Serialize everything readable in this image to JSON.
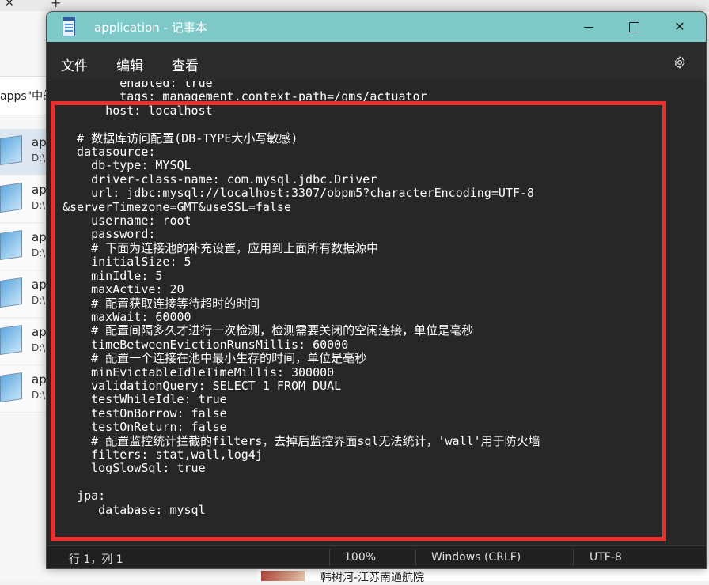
{
  "background": {
    "explorer_strip_text": "apps\"中的",
    "files": [
      {
        "name": "ap",
        "path": "D:\\"
      },
      {
        "name": "ap",
        "path": "D:\\"
      },
      {
        "name": "ap",
        "path": "D:\\"
      },
      {
        "name": "ap",
        "path": "D:\\"
      },
      {
        "name": "ap",
        "path": "D:\\"
      },
      {
        "name": "ap",
        "path": "D:\\"
      }
    ],
    "bottom_text": "韩树河-江苏南通航院"
  },
  "window": {
    "title": "application - 记事本",
    "controls": {
      "minimize": "minimize",
      "maximize": "maximize",
      "close": "✕"
    }
  },
  "menu": {
    "file": "文件",
    "edit": "编辑",
    "view": "查看"
  },
  "editor": {
    "lines": [
      "        enabled: true",
      "        tags: management.context-path=/qms/actuator",
      "      host: localhost",
      "",
      "  # 数据库访问配置(DB-TYPE大小写敏感)",
      "  datasource:",
      "    db-type: MYSQL",
      "    driver-class-name: com.mysql.jdbc.Driver",
      "    url: jdbc:mysql://localhost:3307/obpm5?characterEncoding=UTF-8",
      "&serverTimezone=GMT&useSSL=false",
      "    username: root",
      "    password:",
      "    # 下面为连接池的补充设置，应用到上面所有数据源中",
      "    initialSize: 5",
      "    minIdle: 5",
      "    maxActive: 20",
      "    # 配置获取连接等待超时的时间",
      "    maxWait: 60000",
      "    # 配置间隔多久才进行一次检测，检测需要关闭的空闲连接，单位是毫秒",
      "    timeBetweenEvictionRunsMillis: 60000",
      "    # 配置一个连接在池中最小生存的时间，单位是毫秒",
      "    minEvictableIdleTimeMillis: 300000",
      "    validationQuery: SELECT 1 FROM DUAL",
      "    testWhileIdle: true",
      "    testOnBorrow: false",
      "    testOnReturn: false",
      "    # 配置监控统计拦截的filters，去掉后监控界面sql无法统计，'wall'用于防火墙",
      "    filters: stat,wall,log4j",
      "    logSlowSql: true",
      "",
      "  jpa:",
      "     database: mysql"
    ]
  },
  "status": {
    "position": "行 1，列 1",
    "zoom": "100%",
    "line_ending": "Windows (CRLF)",
    "encoding": "UTF-8"
  },
  "colors": {
    "titlebar": "#7fc8c8",
    "highlight": "#e8302f",
    "editor_bg": "#272727"
  }
}
